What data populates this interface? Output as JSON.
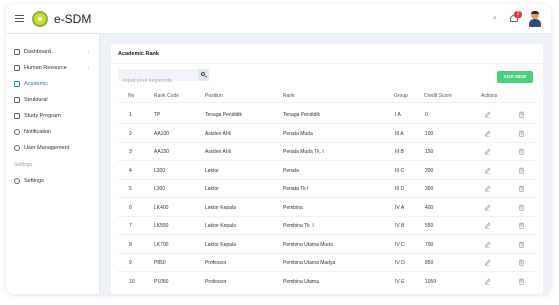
{
  "app": {
    "title": "e-SDM"
  },
  "header": {
    "notification_count": "2"
  },
  "sidebar": {
    "items": [
      {
        "label": "Dashboard",
        "chevron": "›"
      },
      {
        "label": "Human Resource",
        "chevron": "›"
      },
      {
        "label": "Academic"
      },
      {
        "label": "Struktural"
      },
      {
        "label": "Study Program"
      },
      {
        "label": "Notification"
      },
      {
        "label": "User Management"
      }
    ],
    "section_label": "Settings",
    "settings_item": {
      "label": "Settings"
    }
  },
  "page": {
    "title": "Academic Rank",
    "search": {
      "placeholder": "Input your keywords",
      "value": ""
    },
    "add_button": "ADD NEW"
  },
  "table": {
    "headers": [
      "No",
      "Rank Code",
      "Position",
      "Rank",
      "Group",
      "Credit Score",
      "Actions"
    ],
    "rows": [
      {
        "no": "1",
        "code": "TP",
        "position": "Tenaga Pendidik",
        "rank": "Tenaga Pendidik",
        "group": "I A",
        "credit": "0"
      },
      {
        "no": "2",
        "code": "AA100",
        "position": "Asisten Ahli",
        "rank": "Penata Muda",
        "group": "III A",
        "credit": "100"
      },
      {
        "no": "3",
        "code": "AA150",
        "position": "Asisten Ahli",
        "rank": "Penata Muda Tk. I",
        "group": "III B",
        "credit": "150"
      },
      {
        "no": "4",
        "code": "L200",
        "position": "Lektor",
        "rank": "Penata",
        "group": "III C",
        "credit": "200"
      },
      {
        "no": "5",
        "code": "L300",
        "position": "Lektor",
        "rank": "Penata Tk I",
        "group": "III D",
        "credit": "300"
      },
      {
        "no": "6",
        "code": "LK400",
        "position": "Lektor Kepala",
        "rank": "Pembina",
        "group": "IV A",
        "credit": "400"
      },
      {
        "no": "7",
        "code": "LK550",
        "position": "Lektor Kepala",
        "rank": "Pembina Tk. I",
        "group": "IV B",
        "credit": "550"
      },
      {
        "no": "8",
        "code": "LK700",
        "position": "Lektor Kepala",
        "rank": "Pembina Utama Muda",
        "group": "IV C",
        "credit": "700"
      },
      {
        "no": "9",
        "code": "P850",
        "position": "Professor",
        "rank": "Pembina Utama Madya",
        "group": "IV D",
        "credit": "850"
      },
      {
        "no": "10",
        "code": "P1050",
        "position": "Professor",
        "rank": "Pembina Utama",
        "group": "IV E",
        "credit": "1050"
      }
    ]
  },
  "colors": {
    "accent": "#2f7be5",
    "add_button": "#4cd07d",
    "badge": "#e53945"
  },
  "icons": [
    "hamburger-icon",
    "logo-icon",
    "search-icon",
    "bell-icon",
    "avatar-icon",
    "edit-icon",
    "trash-icon"
  ]
}
